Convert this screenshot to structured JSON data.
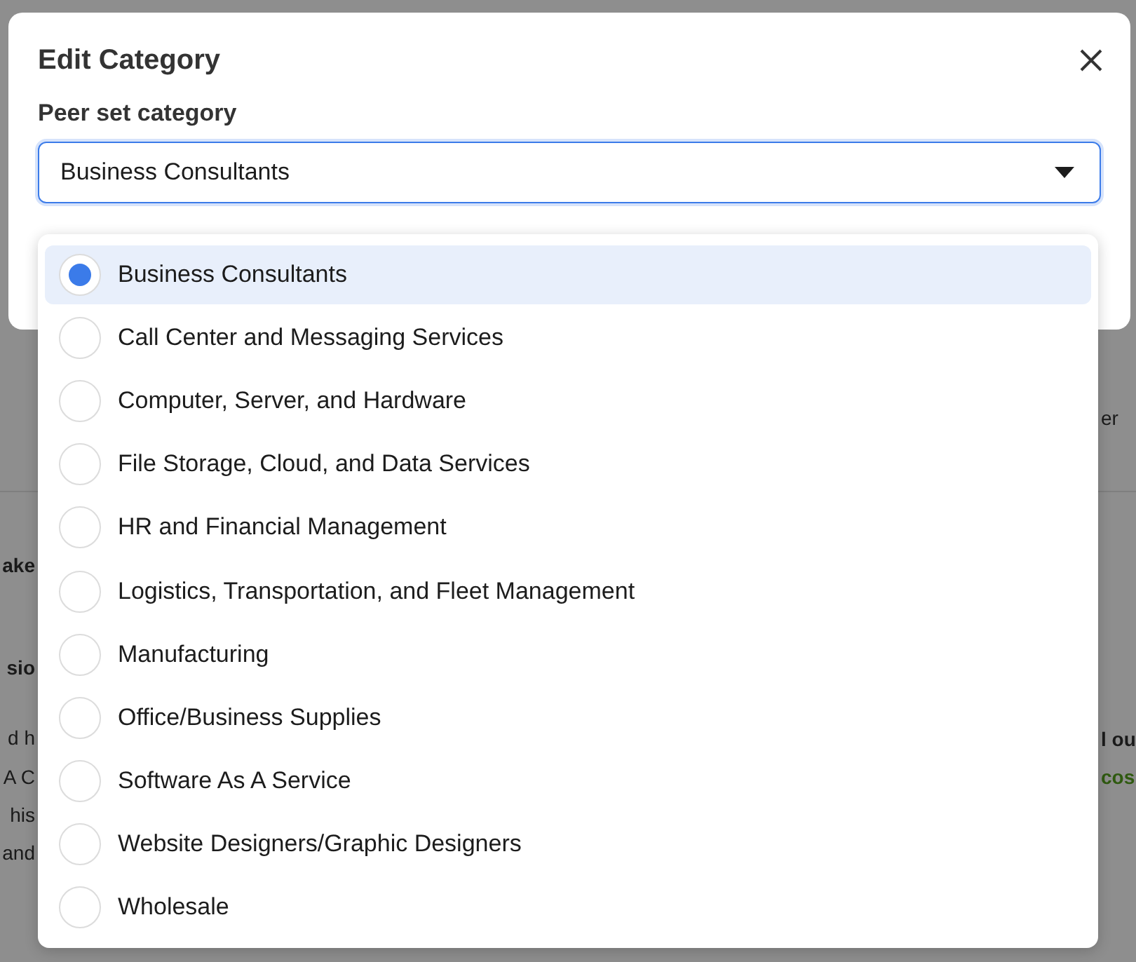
{
  "background": {
    "fragments_left": [
      {
        "text": "ake",
        "bold": true
      },
      {
        "text": "sio",
        "bold": true
      },
      {
        "text": "d h",
        "bold": false
      },
      {
        "text": "A C",
        "bold": false
      },
      {
        "text": "his",
        "bold": false
      },
      {
        "text": "and",
        "bold": false
      }
    ],
    "fragments_right": [
      {
        "text": "er",
        "kind": "plain"
      },
      {
        "text": "l ou",
        "kind": "bold"
      },
      {
        "text": "cos",
        "kind": "green"
      }
    ]
  },
  "dialog": {
    "title": "Edit Category",
    "field_label": "Peer set category",
    "value": "Business Consultants"
  },
  "options": [
    {
      "label": "Business Consultants",
      "selected": true
    },
    {
      "label": "Call Center and Messaging Services",
      "selected": false
    },
    {
      "label": "Computer, Server, and Hardware",
      "selected": false
    },
    {
      "label": "File Storage, Cloud, and Data Services",
      "selected": false
    },
    {
      "label": "HR and Financial Management",
      "selected": false
    },
    {
      "label": "Logistics, Transportation, and Fleet Management",
      "selected": false
    },
    {
      "label": "Manufacturing",
      "selected": false
    },
    {
      "label": "Office/Business Supplies",
      "selected": false
    },
    {
      "label": "Software As A Service",
      "selected": false
    },
    {
      "label": "Website Designers/Graphic Designers",
      "selected": false
    },
    {
      "label": "Wholesale",
      "selected": false
    }
  ]
}
